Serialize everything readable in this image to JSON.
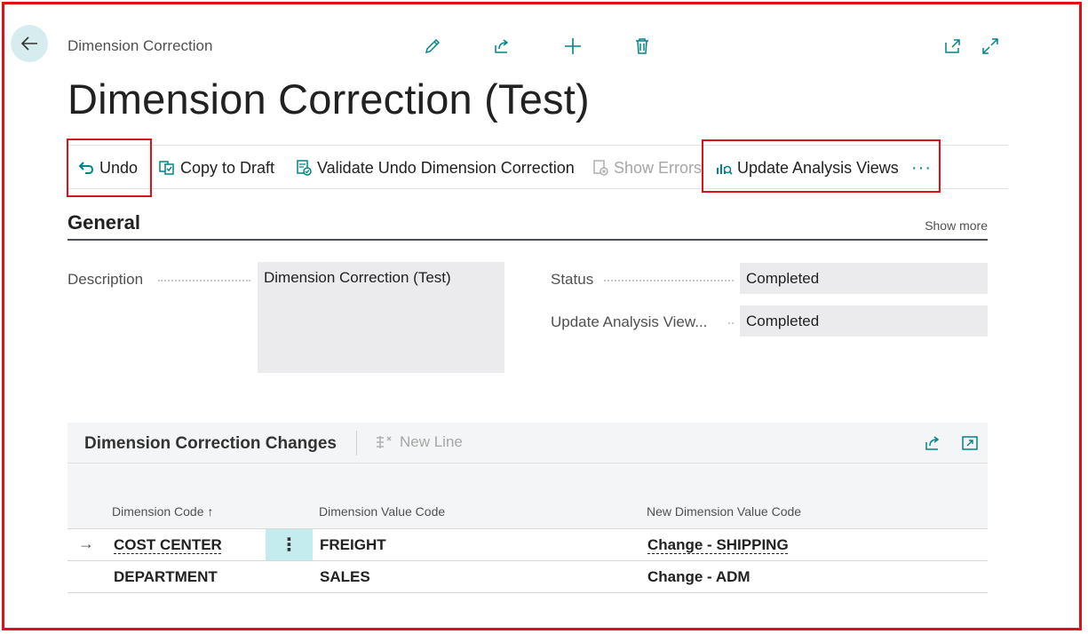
{
  "header": {
    "breadcrumb": "Dimension Correction",
    "title": "Dimension Correction (Test)"
  },
  "actions": {
    "undo": "Undo",
    "copy_to_draft": "Copy to Draft",
    "validate": "Validate Undo Dimension Correction",
    "show_errors": "Show Errors",
    "update_analysis": "Update Analysis Views",
    "more": "···"
  },
  "general": {
    "title": "General",
    "show_more": "Show more",
    "description_label": "Description",
    "description_value": "Dimension Correction (Test)",
    "status_label": "Status",
    "status_value": "Completed",
    "update_label": "Update Analysis View...",
    "update_value": "Completed"
  },
  "lines": {
    "title": "Dimension Correction Changes",
    "new_line": "New Line",
    "columns": {
      "dimension_code": "Dimension Code",
      "sort_indicator": "↑",
      "dimension_value_code": "Dimension Value Code",
      "new_dimension_value_code": "New Dimension Value Code"
    },
    "rows": [
      {
        "dimension_code": "COST CENTER",
        "dimension_value_code": "FREIGHT",
        "new_value": "Change - SHIPPING"
      },
      {
        "dimension_code": "DEPARTMENT",
        "dimension_value_code": "SALES",
        "new_value": "Change - ADM"
      }
    ]
  },
  "colors": {
    "accent": "#008489",
    "highlight": "#e0101a",
    "field_bg": "#ebebed"
  }
}
